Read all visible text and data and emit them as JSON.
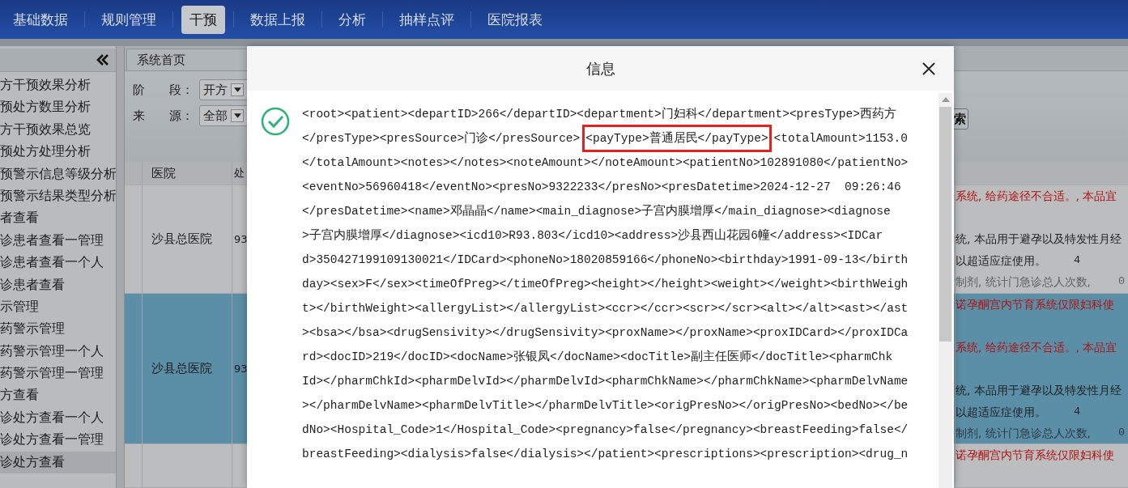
{
  "nav": {
    "tabs": [
      {
        "label": "基础数据",
        "selected": false
      },
      {
        "label": "规则管理",
        "selected": false
      },
      {
        "label": "干预",
        "selected": true
      },
      {
        "label": "数据上报",
        "selected": false
      },
      {
        "label": "分析",
        "selected": false
      },
      {
        "label": "抽样点评",
        "selected": false
      },
      {
        "label": "医院报表",
        "selected": false
      }
    ]
  },
  "sidebar": {
    "items": [
      {
        "label": "方干预效果分析",
        "selected": false
      },
      {
        "label": "预处方数里分析",
        "selected": false
      },
      {
        "label": "方干预效果总览",
        "selected": false
      },
      {
        "label": "预处方处理分析",
        "selected": false
      },
      {
        "label": "预警示信息等级分析",
        "selected": false
      },
      {
        "label": "预警示结果类型分析",
        "selected": false
      },
      {
        "label": "者查看",
        "selected": false
      },
      {
        "label": "诊患者查看一管理",
        "selected": false
      },
      {
        "label": "诊患者查看一个人",
        "selected": false
      },
      {
        "label": "诊患者查看",
        "selected": false
      },
      {
        "label": "示管理",
        "selected": false
      },
      {
        "label": "药警示管理",
        "selected": false
      },
      {
        "label": "药警示管理一个人",
        "selected": false
      },
      {
        "label": "药警示管理一管理",
        "selected": false
      },
      {
        "label": "方查看",
        "selected": false
      },
      {
        "label": "诊处方查看一个人",
        "selected": false
      },
      {
        "label": "诊处方查看一管理",
        "selected": false
      },
      {
        "label": "诊处方查看",
        "selected": true
      }
    ]
  },
  "main": {
    "tab": "系统首页",
    "filters": [
      {
        "label": "阶　　段：",
        "value": "开方"
      },
      {
        "label": "来　　源：",
        "value": "全部"
      }
    ],
    "search_button": "索",
    "table": {
      "columns": [
        "医院",
        "处"
      ],
      "rows": [
        {
          "hospital": "沙县总医院",
          "column_3": "93",
          "selected": false,
          "details": [
            {
              "kind": "warning",
              "text": "系统, 给药途径不合适。, 本品宜"
            },
            {
              "kind": "normal",
              "text": "统, 本品用于避孕以及特发性月经"
            },
            {
              "kind": "normal",
              "text": "以超适应症使用。",
              "value": "4"
            },
            {
              "kind": "muted",
              "text": "制剂, 统计门急诊总人次数,",
              "value": "0"
            }
          ]
        },
        {
          "hospital": "沙县总医院",
          "column_3": "93",
          "selected": true,
          "details": [
            {
              "kind": "warning",
              "text": "诺孕酮宫内节育系统仅限妇科使"
            },
            {
              "kind": "warning",
              "text": "系统, 给药途径不合适。, 本品宜"
            },
            {
              "kind": "normal",
              "text": "统, 本品用于避孕以及特发性月经"
            },
            {
              "kind": "normal",
              "text": "以超适应症使用。",
              "value": "4"
            },
            {
              "kind": "muted",
              "text": "制剂, 统计门急诊总人次数,",
              "value": "0"
            }
          ]
        },
        {
          "selected": false,
          "details": [
            {
              "kind": "warning",
              "text": "诺孕酮宫内节育系统仅限妇科使"
            }
          ]
        }
      ]
    }
  },
  "dialog": {
    "title": "信息",
    "lines": [
      {
        "text": "<root><patient><departID>266</departID><department>门妇科</department><presType>西药方"
      },
      {
        "segments": [
          {
            "text": "</presType><presSource>门诊</presSource>",
            "highlighted": false
          },
          {
            "text": "<payType>普通居民</payType>",
            "highlighted": true
          },
          {
            "text": "<totalAmount>1153.0",
            "highlighted": false
          }
        ]
      },
      {
        "text": "</totalAmount><notes></notes><noteAmount></noteAmount><patientNo>102891080</patientNo>"
      },
      {
        "text": "<eventNo>56960418</eventNo><presNo>9322233</presNo><presDatetime>2024-12-27  09:26:46"
      },
      {
        "text": "</presDatetime><name>邓晶晶</name><main_diagnose>子宫内膜增厚</main_diagnose><diagnose"
      },
      {
        "text": ">子宫内膜增厚</diagnose><icd10>R93.803</icd10><address>沙县西山花园6幢</address><IDCar"
      },
      {
        "text": "d>350427199109130021</IDCard><phoneNo>18020859166</phoneNo><birthday>1991-09-13</birth"
      },
      {
        "text": "day><sex>F</sex><timeOfPreg></timeOfPreg><height></height><weight></weight><birthWeigh"
      },
      {
        "text": "t></birthWeight><allergyList></allergyList><ccr></ccr><scr></scr><alt></alt><ast></ast"
      },
      {
        "text": "><bsa></bsa><drugSensivity></drugSensivity><proxName></proxName><proxIDCard></proxIDCa"
      },
      {
        "text": "rd><docID>219</docID><docName>张银凤</docName><docTitle>副主任医师</docTitle><pharmChk"
      },
      {
        "text": "Id></pharmChkId><pharmDelvId></pharmDelvId><pharmChkName></pharmChkName><pharmDelvName"
      },
      {
        "text": "></pharmDelvName><pharmDelvTitle></pharmDelvTitle><origPresNo></origPresNo><bedNo></be"
      },
      {
        "text": "dNo><Hospital_Code>1</Hospital_Code><pregnancy>false</pregnancy><breastFeeding>false</"
      },
      {
        "text": "breastFeeding><dialysis>false</dialysis></patient><prescriptions><prescription><drug_n"
      }
    ]
  }
}
